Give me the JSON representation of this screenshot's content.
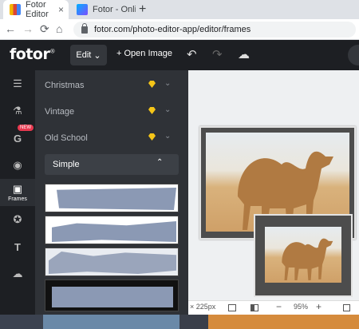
{
  "browser": {
    "tabs": [
      {
        "title": "Fotor Editor",
        "close": "×"
      },
      {
        "title": "Fotor - Online Fo",
        "close": "×"
      }
    ],
    "new_tab": "+",
    "nav": {
      "back": "←",
      "forward": "→",
      "reload": "⟳",
      "home": "⌂"
    },
    "url": "fotor.com/photo-editor-app/editor/frames"
  },
  "app": {
    "logo": "fotor",
    "logo_mark": "®",
    "edit_label": "Edit",
    "edit_chevron": "⌄",
    "open_image": "+ Open Image",
    "undo_icon": "↶",
    "redo_icon": "↷",
    "cloud_icon": "☁"
  },
  "rail": {
    "items": [
      {
        "name": "adjust",
        "glyph": "☰"
      },
      {
        "name": "beauty",
        "glyph": "⚗"
      },
      {
        "name": "ai-tools",
        "glyph": "G",
        "badge": "NEW"
      },
      {
        "name": "eye",
        "glyph": "◉"
      },
      {
        "name": "frames",
        "glyph": "▣",
        "label": "Frames"
      },
      {
        "name": "stickers",
        "glyph": "✪"
      },
      {
        "name": "text",
        "glyph": "T"
      },
      {
        "name": "upload",
        "glyph": "☁"
      }
    ]
  },
  "panel": {
    "categories": [
      {
        "label": "Christmas",
        "premium": true,
        "chevron": "⌄"
      },
      {
        "label": "Vintage",
        "premium": true,
        "chevron": "⌄"
      },
      {
        "label": "Old School",
        "premium": true,
        "chevron": "⌄"
      }
    ],
    "selected": {
      "label": "Simple",
      "chevron": "⌃"
    },
    "collapse_icon": "‹"
  },
  "bottom": {
    "size": "× 225px",
    "zoom": "95%",
    "minus": "−",
    "plus": "+"
  },
  "colors": {
    "accent_gem": "#f5c518",
    "new_badge": "#e8384f",
    "panel_bg": "#2f3237",
    "topbar_bg": "#1d1f23"
  }
}
